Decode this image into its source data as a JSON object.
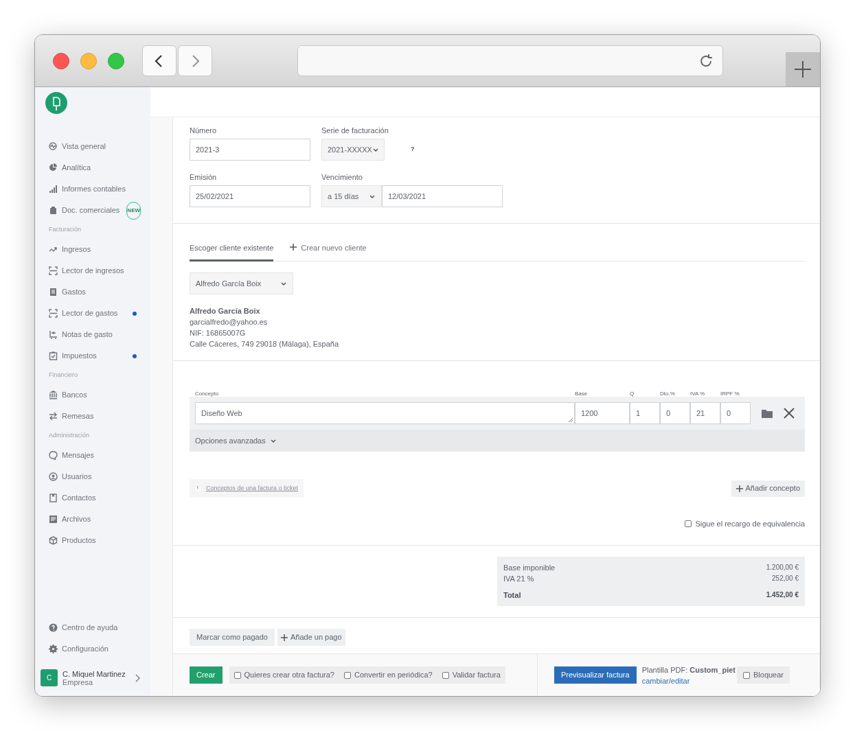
{
  "browser": {
    "buttons": [
      {
        "kind": "back"
      },
      {
        "kind": "forward"
      }
    ]
  },
  "sidebar": {
    "groups": [
      {
        "items": [
          {
            "label": "Vista general",
            "dot": false
          },
          {
            "label": "Analítica",
            "dot": false
          },
          {
            "label": "Informes contables",
            "dot": false
          },
          {
            "label": "Doc. comerciales",
            "dot": false,
            "badge": "NEW"
          }
        ]
      },
      {
        "heading": "Facturación",
        "items": [
          {
            "label": "Ingresos",
            "dot": false
          },
          {
            "label": "Lector de ingresos",
            "dot": false
          },
          {
            "label": "Gastos",
            "dot": false
          },
          {
            "label": "Lector de gastos",
            "dot": true
          },
          {
            "label": "Notas de gasto",
            "dot": false
          },
          {
            "label": "Impuestos",
            "dot": true
          }
        ]
      },
      {
        "heading": "Financiero",
        "items": [
          {
            "label": "Bancos",
            "dot": false
          },
          {
            "label": "Remesas",
            "dot": false
          }
        ]
      },
      {
        "heading": "Administración",
        "items": [
          {
            "label": "Mensajes",
            "dot": false
          },
          {
            "label": "Usuarios",
            "dot": false
          },
          {
            "label": "Contactos",
            "dot": false
          },
          {
            "label": "Archivos",
            "dot": false
          },
          {
            "label": "Productos",
            "dot": false
          }
        ]
      }
    ],
    "bottom_items": [
      {
        "label": "Centro de ayuda"
      },
      {
        "label": "Configuración"
      }
    ],
    "user": {
      "initial": "C",
      "name": "C. Miquel Martinez",
      "role": "Empresa"
    }
  },
  "invoice": {
    "numero": {
      "label": "Número",
      "value": "2021-3"
    },
    "serie": {
      "label": "Serie de facturación",
      "value": "2021-XXXXX",
      "help": "?"
    },
    "emision": {
      "label": "Emisión",
      "value": "25/02/2021"
    },
    "vencimiento": {
      "label": "Vencimiento",
      "term": "a 15 días",
      "value": "12/03/2021"
    }
  },
  "client": {
    "tabs": [
      {
        "label": "Escoger cliente existente",
        "selected": true,
        "plus": false
      },
      {
        "label": "Crear nuevo cliente",
        "selected": false,
        "plus": true
      }
    ],
    "select": "Alfredo García Boix",
    "name": "Alfredo García Boix",
    "email": "garcialfredo@yahoo.es",
    "nif": "NIF: 16865007G",
    "address": "Calle Cáceres, 749 29018 (Málaga), España"
  },
  "lines": {
    "columns": [
      "Concepto",
      "Base",
      "Q",
      "Dto.%",
      "IVA %",
      "IRPF %"
    ],
    "rows": [
      {
        "values": [
          "Diseño Web",
          "1200",
          "1",
          "0",
          "21",
          "0"
        ]
      }
    ],
    "advanced": "Opciones avanzadas",
    "hint_icon": "!",
    "hint": "Conceptos de una factura o ticket",
    "add": "Añadir concepto",
    "recargo": {
      "label": "Sigue el recargo de equivalencia",
      "checked": false
    }
  },
  "totals": [
    {
      "label": "Base imponible",
      "value": "1.200,00 €",
      "bold": false
    },
    {
      "label": "IVA 21 %",
      "value": "252,00 €",
      "bold": false
    },
    {
      "label": "Total",
      "value": "1.452,00 €",
      "bold": true
    }
  ],
  "payment_buttons": [
    {
      "label": "Marcar como pagado",
      "plus": false
    },
    {
      "label": "Añade un pago",
      "plus": true
    }
  ],
  "footer": {
    "create": "Crear",
    "options": [
      {
        "label": "Quieres crear otra factura?",
        "checked": false
      },
      {
        "label": "Convertir en periódica?",
        "checked": false
      },
      {
        "label": "Validar factura",
        "checked": false
      }
    ],
    "preview": "Previsualizar factura",
    "template": "Plantilla PDF: **Custom_piet**",
    "template_link": "cambiar/editar",
    "lock": {
      "label": "Bloquear",
      "checked": false
    }
  }
}
